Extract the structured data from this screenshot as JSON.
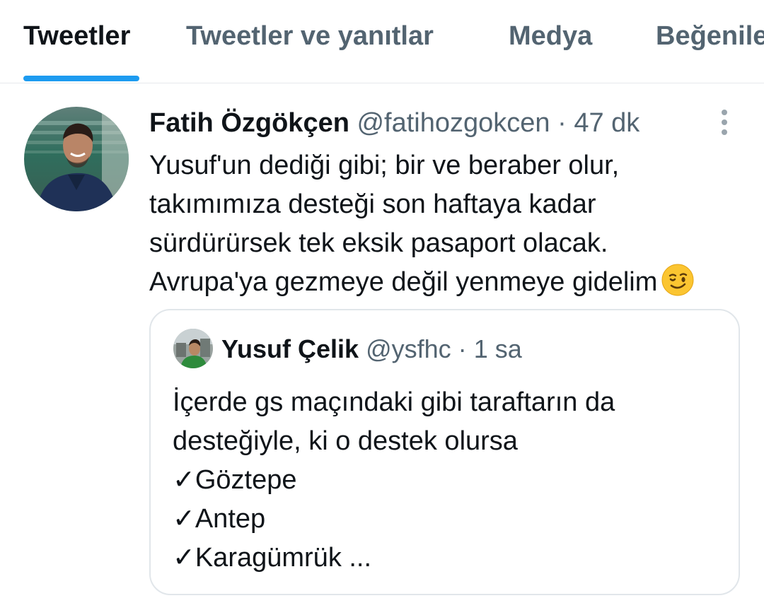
{
  "tabs": [
    {
      "label": "Tweetler",
      "active": true
    },
    {
      "label": "Tweetler ve yanıtlar",
      "active": false
    },
    {
      "label": "Medya",
      "active": false
    },
    {
      "label": "Beğenile",
      "active": false
    }
  ],
  "tweet": {
    "author_name": "Fatih Özgökçen",
    "author_handle": "@fatihozgokcen",
    "separator": "·",
    "time": "47 dk",
    "text_lines": [
      "Yusuf'un dediği gibi; bir ve beraber olur,",
      "takımımıza desteği son haftaya kadar",
      "sürdürürsek tek eksik pasaport olacak.",
      "Avrupa'ya gezmeye değil yenmeye gidelim"
    ],
    "emoji": "winking-face"
  },
  "quoted_tweet": {
    "author_name": "Yusuf Çelik",
    "author_handle": "@ysfhc",
    "separator": "·",
    "time": "1 sa",
    "text_lines": [
      "İçerde gs maçındaki gibi taraftarın da",
      "desteğiyle, ki o destek olursa",
      "✓Göztepe",
      "✓Antep",
      "✓Karagümrük ..."
    ]
  },
  "colors": {
    "accent": "#1d9bf0",
    "primary_text": "#0f1419",
    "secondary_text": "#536471",
    "border": "#e1e6ea"
  }
}
